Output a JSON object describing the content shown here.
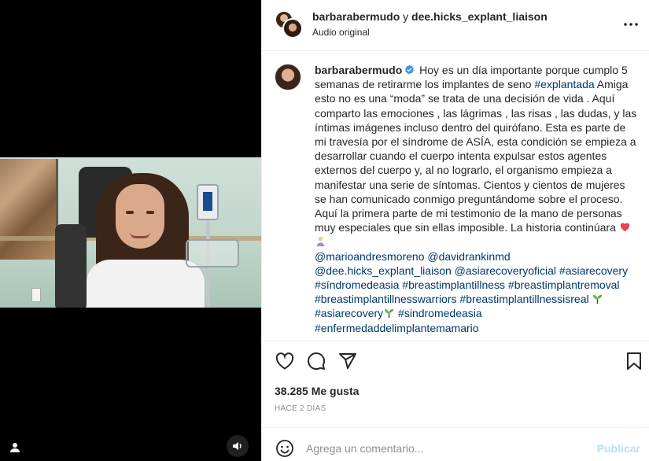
{
  "post_header": {
    "user1": "barbarabermudo",
    "separator": "y",
    "user2": "dee.hicks_explant_liaison",
    "audio": "Audio original"
  },
  "caption": {
    "username": "barbarabermudo",
    "seg1": "Hoy es un día importante porque cumplo 5 semanas de retirarme los implantes de seno ",
    "tag1": "#explantada",
    "seg2": " Amiga esto no es una “moda” se trata de una decisión de vida . Aquí comparto las emociones , las lágrimas , las risas , las dudas, y las íntimas imágenes incluso dentro del quirófano. Esta es parte de mi travesía por el síndrome de ASÍA, esta condición se empieza a desarrollar cuando el cuerpo intenta expulsar estos agentes externos del cuerpo y, al no lograrlo, el organismo empieza a manifestar una serie de síntomas. Cientos y cientos de mujeres se han comunicado conmigo preguntándome sobre el proceso. Aquí la primera parte de mi testimonio de la mano de personas muy especiales que sin ellas imposible. La historia continúara",
    "mention1": "@marioandresmoreno",
    "mention2": "@davidrankinmd",
    "mention3": "@dee.hicks_explant_liaison",
    "mention4": "@asiarecoveryoficial",
    "tag2": "#asiarecovery",
    "tag3": "#síndromedeasia",
    "tag4": "#breastimplantillness",
    "tag5": "#breastimplantremoval",
    "tag6": "#breastimplantillnesswarriors",
    "tag7": "#breastimplantillnessisreal",
    "tag8": "#asiarecovery",
    "tag9": "#sindromedeasia",
    "tag10": "#enfermedaddelimplantemamario"
  },
  "engagement": {
    "likes": "38.285 Me gusta",
    "time": "HACE 2 DÍAS"
  },
  "comment": {
    "placeholder": "Agrega un comentario...",
    "post_label": "Publicar"
  },
  "icons": {
    "more": "more-options-icon",
    "like": "heart-icon",
    "comment": "comment-icon",
    "share": "share-icon",
    "save": "bookmark-icon",
    "emoji": "emoji-icon",
    "audio": "speaker-icon",
    "tag": "user-tag-icon",
    "verified": "verified-badge-icon"
  },
  "colors": {
    "link": "#00376b",
    "verified": "#3897f0",
    "post_disabled": "#b2dffc"
  }
}
